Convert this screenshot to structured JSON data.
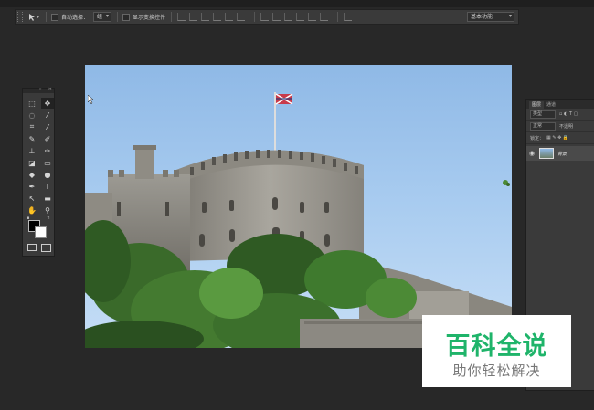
{
  "options_bar": {
    "auto_select_label": "自动选择：",
    "auto_select_value": "组",
    "show_transform_label": "显示变换控件",
    "workspace_label": "基本功能"
  },
  "layers_panel": {
    "tabs": [
      "图层",
      "通道"
    ],
    "kind_filter": "类型",
    "blend_mode": "正常",
    "opacity_label": "不透明",
    "lock_label": "锁定：",
    "layer_name": "背景"
  },
  "watermark": {
    "title": "百科全说",
    "subtitle": "助你轻松解决"
  },
  "colors": {
    "brand_green": "#1fb46a",
    "panel_bg": "#3a3a3a",
    "workspace_bg": "#282828"
  }
}
